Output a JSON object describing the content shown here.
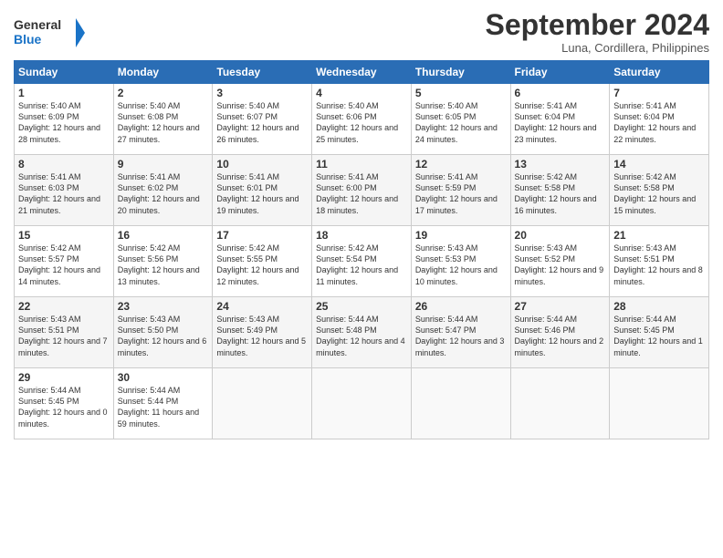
{
  "logo": {
    "line1": "General",
    "line2": "Blue",
    "icon": "▶"
  },
  "title": "September 2024",
  "subtitle": "Luna, Cordillera, Philippines",
  "headers": [
    "Sunday",
    "Monday",
    "Tuesday",
    "Wednesday",
    "Thursday",
    "Friday",
    "Saturday"
  ],
  "weeks": [
    [
      {
        "day": "1",
        "sunrise": "5:40 AM",
        "sunset": "6:09 PM",
        "daylight": "12 hours and 28 minutes."
      },
      {
        "day": "2",
        "sunrise": "5:40 AM",
        "sunset": "6:08 PM",
        "daylight": "12 hours and 27 minutes."
      },
      {
        "day": "3",
        "sunrise": "5:40 AM",
        "sunset": "6:07 PM",
        "daylight": "12 hours and 26 minutes."
      },
      {
        "day": "4",
        "sunrise": "5:40 AM",
        "sunset": "6:06 PM",
        "daylight": "12 hours and 25 minutes."
      },
      {
        "day": "5",
        "sunrise": "5:40 AM",
        "sunset": "6:05 PM",
        "daylight": "12 hours and 24 minutes."
      },
      {
        "day": "6",
        "sunrise": "5:41 AM",
        "sunset": "6:04 PM",
        "daylight": "12 hours and 23 minutes."
      },
      {
        "day": "7",
        "sunrise": "5:41 AM",
        "sunset": "6:04 PM",
        "daylight": "12 hours and 22 minutes."
      }
    ],
    [
      {
        "day": "8",
        "sunrise": "5:41 AM",
        "sunset": "6:03 PM",
        "daylight": "12 hours and 21 minutes."
      },
      {
        "day": "9",
        "sunrise": "5:41 AM",
        "sunset": "6:02 PM",
        "daylight": "12 hours and 20 minutes."
      },
      {
        "day": "10",
        "sunrise": "5:41 AM",
        "sunset": "6:01 PM",
        "daylight": "12 hours and 19 minutes."
      },
      {
        "day": "11",
        "sunrise": "5:41 AM",
        "sunset": "6:00 PM",
        "daylight": "12 hours and 18 minutes."
      },
      {
        "day": "12",
        "sunrise": "5:41 AM",
        "sunset": "5:59 PM",
        "daylight": "12 hours and 17 minutes."
      },
      {
        "day": "13",
        "sunrise": "5:42 AM",
        "sunset": "5:58 PM",
        "daylight": "12 hours and 16 minutes."
      },
      {
        "day": "14",
        "sunrise": "5:42 AM",
        "sunset": "5:58 PM",
        "daylight": "12 hours and 15 minutes."
      }
    ],
    [
      {
        "day": "15",
        "sunrise": "5:42 AM",
        "sunset": "5:57 PM",
        "daylight": "12 hours and 14 minutes."
      },
      {
        "day": "16",
        "sunrise": "5:42 AM",
        "sunset": "5:56 PM",
        "daylight": "12 hours and 13 minutes."
      },
      {
        "day": "17",
        "sunrise": "5:42 AM",
        "sunset": "5:55 PM",
        "daylight": "12 hours and 12 minutes."
      },
      {
        "day": "18",
        "sunrise": "5:42 AM",
        "sunset": "5:54 PM",
        "daylight": "12 hours and 11 minutes."
      },
      {
        "day": "19",
        "sunrise": "5:43 AM",
        "sunset": "5:53 PM",
        "daylight": "12 hours and 10 minutes."
      },
      {
        "day": "20",
        "sunrise": "5:43 AM",
        "sunset": "5:52 PM",
        "daylight": "12 hours and 9 minutes."
      },
      {
        "day": "21",
        "sunrise": "5:43 AM",
        "sunset": "5:51 PM",
        "daylight": "12 hours and 8 minutes."
      }
    ],
    [
      {
        "day": "22",
        "sunrise": "5:43 AM",
        "sunset": "5:51 PM",
        "daylight": "12 hours and 7 minutes."
      },
      {
        "day": "23",
        "sunrise": "5:43 AM",
        "sunset": "5:50 PM",
        "daylight": "12 hours and 6 minutes."
      },
      {
        "day": "24",
        "sunrise": "5:43 AM",
        "sunset": "5:49 PM",
        "daylight": "12 hours and 5 minutes."
      },
      {
        "day": "25",
        "sunrise": "5:44 AM",
        "sunset": "5:48 PM",
        "daylight": "12 hours and 4 minutes."
      },
      {
        "day": "26",
        "sunrise": "5:44 AM",
        "sunset": "5:47 PM",
        "daylight": "12 hours and 3 minutes."
      },
      {
        "day": "27",
        "sunrise": "5:44 AM",
        "sunset": "5:46 PM",
        "daylight": "12 hours and 2 minutes."
      },
      {
        "day": "28",
        "sunrise": "5:44 AM",
        "sunset": "5:45 PM",
        "daylight": "12 hours and 1 minute."
      }
    ],
    [
      {
        "day": "29",
        "sunrise": "5:44 AM",
        "sunset": "5:45 PM",
        "daylight": "12 hours and 0 minutes."
      },
      {
        "day": "30",
        "sunrise": "5:44 AM",
        "sunset": "5:44 PM",
        "daylight": "11 hours and 59 minutes."
      },
      null,
      null,
      null,
      null,
      null
    ]
  ]
}
